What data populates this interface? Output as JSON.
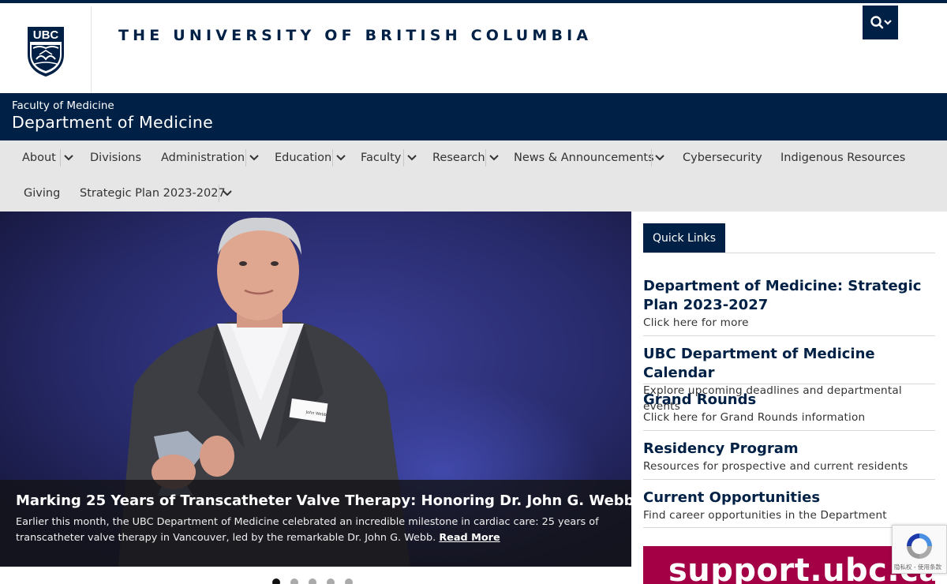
{
  "header": {
    "logo_text": "UBC",
    "university_title": "THE UNIVERSITY OF BRITISH COLUMBIA"
  },
  "dept": {
    "faculty": "Faculty of Medicine",
    "department": "Department of Medicine"
  },
  "nav": {
    "items": [
      "About",
      "Divisions",
      "Administration",
      "Education",
      "Faculty",
      "Research",
      "News & Announcements",
      "Cybersecurity",
      "Indigenous Resources",
      "Giving",
      "Strategic Plan 2023-2027"
    ]
  },
  "hero": {
    "badge_text": "John Webb",
    "title": "Marking 25 Years of Transcatheter Valve Therapy: Honoring Dr. John G. Webb",
    "text": "Earlier this month, the UBC Department of Medicine celebrated an incredible milestone in cardiac care: 25 years of transcatheter valve therapy in Vancouver, led by the remarkable Dr. John G. Webb.",
    "read_more": "Read More",
    "slide_count": 5,
    "active_slide": 1
  },
  "quick_links": {
    "tab_label": "Quick Links",
    "items": [
      {
        "title": "Department of Medicine: Strategic Plan 2023-2027",
        "sub": "Click here for more"
      },
      {
        "title": "UBC Department of Medicine Calendar",
        "sub": "Explore upcoming deadlines and departmental events"
      },
      {
        "title": "Grand Rounds",
        "sub": "Click here for Grand Rounds information"
      },
      {
        "title": "Residency Program",
        "sub": "Resources for prospective and current residents"
      },
      {
        "title": "Current Opportunities",
        "sub": "Find career opportunities in the Department"
      }
    ]
  },
  "support_banner": "support.ubc.ca",
  "recaptcha": {
    "text": "隐私权 - 使用条款"
  },
  "colors": {
    "ubc_blue": "#002145",
    "nav_bg": "#e6e6e6",
    "support_magenta": "#a30046"
  },
  "icons": [
    "ubc-crest-icon",
    "search-icon",
    "chevron-down-icon",
    "recaptcha-icon"
  ]
}
